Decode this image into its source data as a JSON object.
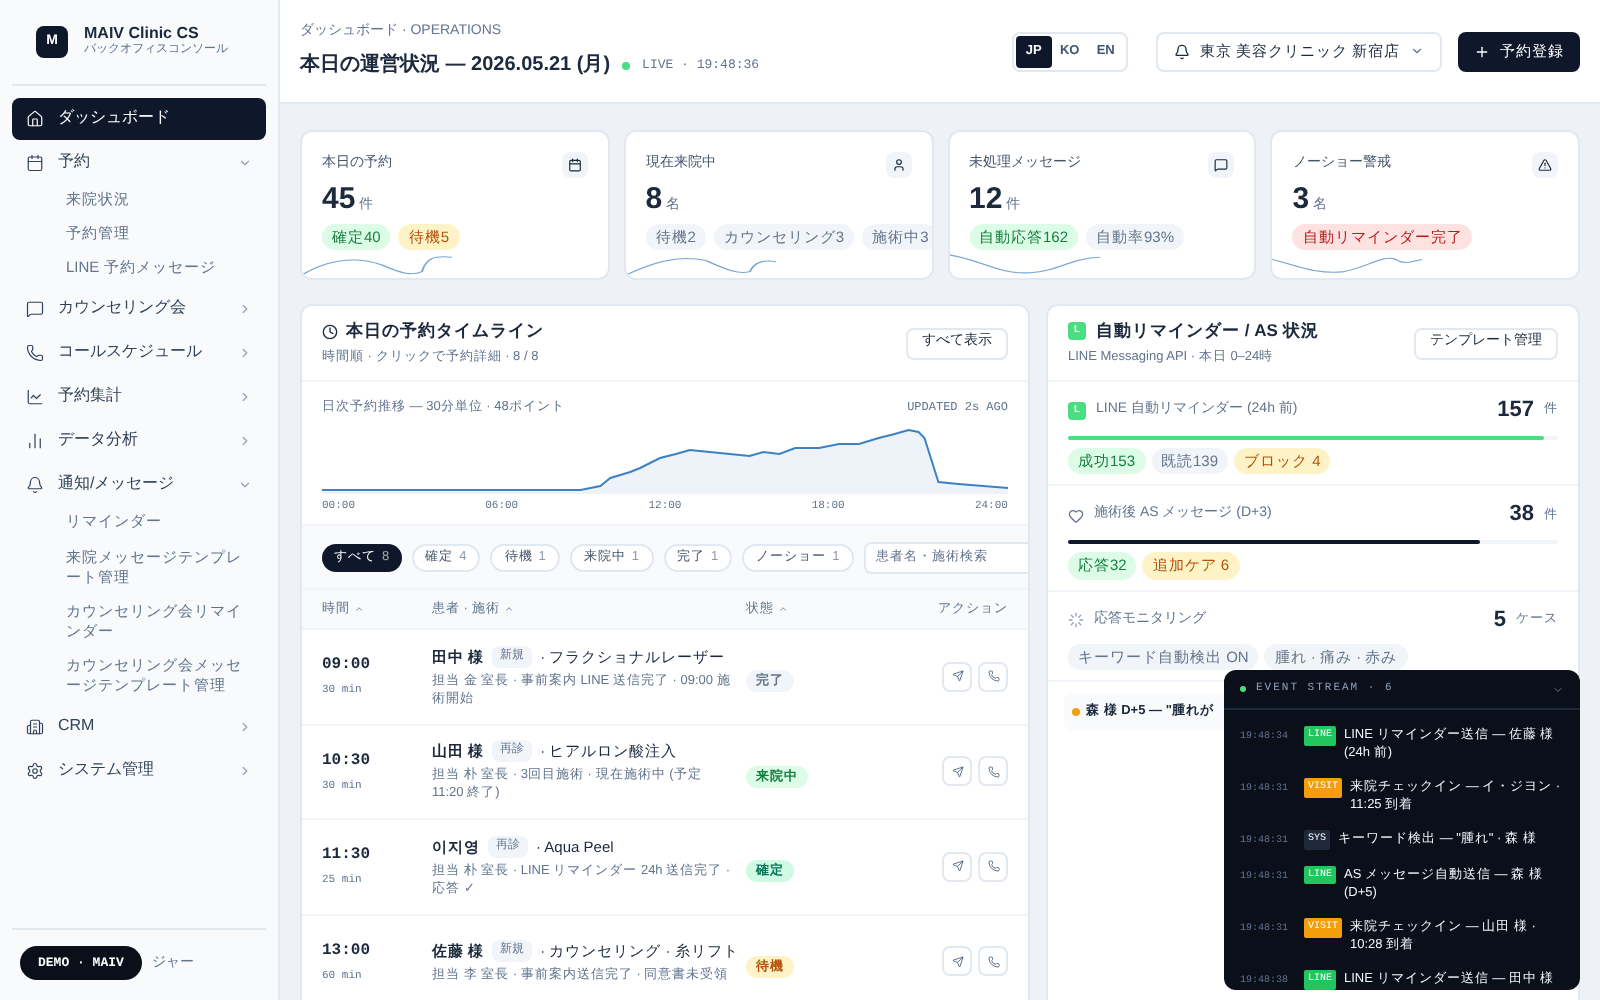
{
  "sidebar": {
    "logo": "M",
    "brand": "MAIV Clinic CS",
    "subtitle": "バックオフィスコンソール",
    "nav": [
      {
        "label": "ダッシュボード",
        "selected": true
      },
      {
        "label": "予約",
        "selected": false,
        "expanded": true,
        "children": [
          {
            "label": "来院状況"
          },
          {
            "label": "予約管理"
          },
          {
            "label": "LINE 予約メッセージ"
          }
        ]
      },
      {
        "label": "カウンセリング会",
        "selected": false,
        "expanded": false
      },
      {
        "label": "コールスケジュール",
        "selected": false,
        "expanded": false
      },
      {
        "label": "予約集計",
        "selected": false,
        "expanded": false
      },
      {
        "label": "データ分析",
        "selected": false,
        "expanded": false
      },
      {
        "label": "通知/メッセージ",
        "selected": false,
        "expanded": true,
        "children": [
          {
            "label": "リマインダー"
          },
          {
            "label": "来院メッセージテンプレート管理"
          },
          {
            "label": "カウンセリング会リマインダー"
          },
          {
            "label": "カウンセリング会メッセージテンプレート管理"
          }
        ]
      },
      {
        "label": "CRM",
        "selected": false,
        "expanded": false
      },
      {
        "label": "システム管理",
        "selected": false,
        "expanded": false
      }
    ],
    "footer_role": "ジャー"
  },
  "header": {
    "breadcrumb": "ダッシュボード · OPERATIONS",
    "title": "本日の運営状況 — 2026.05.21 (月)",
    "live": "LIVE · 19:48:36",
    "languages": [
      {
        "label": "JP",
        "selected": true
      },
      {
        "label": "KO",
        "selected": false
      },
      {
        "label": "EN",
        "selected": false
      }
    ],
    "clinic": "東京 美容クリニック 新宿店",
    "primary_button": "予約登録"
  },
  "stat_cards": [
    {
      "label": "本日の予約",
      "value": "45",
      "unit": "件",
      "tags": [
        {
          "label": "確定40",
          "color": "#dcfce7"
        },
        {
          "label": "待機5",
          "color": "#fef3c7"
        }
      ]
    },
    {
      "label": "現在来院中",
      "value": "8",
      "unit": "名",
      "tags": [
        {
          "label": "待機2",
          "color": "#f1f5f9"
        },
        {
          "label": "カウンセリング3",
          "color": "#f1f5f9"
        },
        {
          "label": "施術中3",
          "color": "#f1f5f9"
        }
      ]
    },
    {
      "label": "未処理メッセージ",
      "value": "12",
      "unit": "件",
      "tags": [
        {
          "label": "自動応答162",
          "color": "#dcfce7"
        },
        {
          "label": "自動率93%",
          "color": "#f1f5f9"
        }
      ]
    },
    {
      "label": "ノーショー警戒",
      "value": "3",
      "unit": "名",
      "tags": [
        {
          "label": "自動リマインダー完了",
          "color": "#fee2e2"
        }
      ]
    }
  ],
  "timeline": {
    "title": "本日の予約タイムライン",
    "subtitle": "時間順 · クリックで予約詳細 · 8 / 8",
    "button": "すべて表示",
    "chart": {
      "caption": "日次予約推移 — 30分単位 · 48ポイント",
      "updated": "UPDATED 2s AGO",
      "x_labels": [
        "00:00",
        "06:00",
        "12:00",
        "18:00",
        "24:00"
      ]
    },
    "filters": [
      {
        "label": "すべて",
        "count": "8",
        "selected": true
      },
      {
        "label": "確定",
        "count": "4",
        "selected": false
      },
      {
        "label": "待機",
        "count": "1",
        "selected": false
      },
      {
        "label": "来院中",
        "count": "1",
        "selected": false
      },
      {
        "label": "完了",
        "count": "1",
        "selected": false
      },
      {
        "label": "ノーショー",
        "count": "1",
        "selected": false
      }
    ],
    "search": {
      "placeholder": "患者名・施術検索"
    },
    "columns": [
      {
        "label": "時間",
        "sortable": true
      },
      {
        "label": "患者 · 施術",
        "sortable": true
      },
      {
        "label": "状態",
        "sortable": true
      },
      {
        "label": "アクション",
        "sortable": false
      }
    ],
    "rows": [
      {
        "time": "09:00",
        "duration": "30 min",
        "patient": "田中 様",
        "visit": "新規",
        "treatment": "· フラクショナルレーザー",
        "detail": "担当 金 室長 · 事前案内 LINE 送信完了 · 09:00 施術開始",
        "status": "完了",
        "color": "#f1f5f9"
      },
      {
        "time": "10:30",
        "duration": "30 min",
        "patient": "山田 様",
        "visit": "再診",
        "treatment": "· ヒアルロン酸注入",
        "detail": "担当 朴 室長 · 3回目施術 · 現在施術中 (予定 11:20 終了)",
        "status": "来院中",
        "color": "#dcfce7"
      },
      {
        "time": "11:30",
        "duration": "25 min",
        "patient": "이지영",
        "visit": "再診",
        "treatment": "· Aqua Peel",
        "detail": "担当 朴 室長 · LINE リマインダー 24h 送信完了 · 応答 ✓",
        "status": "確定",
        "color": "#d1fae5"
      },
      {
        "time": "13:00",
        "duration": "60 min",
        "patient": "佐藤 様",
        "visit": "新規",
        "treatment": "· カウンセリング · 糸リフト",
        "detail": "担当 李 室長 · 事前案内送信完了 · 同意書未受領",
        "status": "待機",
        "color": "#fef3c7"
      }
    ]
  },
  "reminders": {
    "logo": "L",
    "title": "自動リマインダー / AS 状況",
    "subtitle": "LINE Messaging API · 本日 0–24時",
    "button": "テンプレート管理",
    "sections": [
      {
        "kind": "line",
        "logo": "L",
        "label": "LINE 自動リマインダー (24h 前)",
        "value": "157",
        "unit": "件",
        "level": 0.97,
        "color": "#4ade80",
        "tags": [
          {
            "label": "成功153",
            "color": "#dcfce7"
          },
          {
            "label": "既読139",
            "color": "#f1f5f9"
          },
          {
            "label": "ブロック 4",
            "color": "#fef3c7"
          }
        ]
      },
      {
        "kind": "heart",
        "label": "施術後 AS メッセージ (D+3)",
        "value": "38",
        "unit": "件",
        "level": 0.84,
        "color": "#0f172a",
        "tags": [
          {
            "label": "応答32",
            "color": "#dcfce7"
          },
          {
            "label": "追加ケア 6",
            "color": "#fef3c7"
          }
        ]
      },
      {
        "kind": "monitor",
        "label": "応答モニタリング",
        "value": "5",
        "unit": "ケース",
        "tags": [
          {
            "label": "キーワード自動検出 ON",
            "color": "#f1f5f9"
          },
          {
            "label": "腫れ · 痛み · 赤み",
            "color": "#f1f5f9"
          }
        ]
      }
    ],
    "alert": "森 様 D+5 — \"腫れが"
  },
  "event_stream": {
    "title": "EVENT STREAM · 6",
    "events": [
      {
        "time": "19:48:34",
        "tag": "LINE",
        "color": "#22c55e",
        "text": "LINE リマインダー送信 — 佐藤 様 (24h 前)"
      },
      {
        "time": "19:48:31",
        "tag": "VISIT",
        "color": "#f59e0b",
        "text": "来院チェックイン — イ・ジヨン · 11:25 到着"
      },
      {
        "time": "19:48:31",
        "tag": "SYS",
        "color": "#1e293b",
        "text": "キーワード検出 — \"腫れ\" · 森 様"
      },
      {
        "time": "19:48:31",
        "tag": "LINE",
        "color": "#22c55e",
        "text": "AS メッセージ自動送信 — 森 様 (D+5)"
      },
      {
        "time": "19:48:31",
        "tag": "VISIT",
        "color": "#f59e0b",
        "text": "来院チェックイン — 山田 様 · 10:28 到着"
      },
      {
        "time": "19:48:38",
        "tag": "LINE",
        "color": "#22c55e",
        "text": "LINE リマインダー送信 — 田中 様"
      }
    ]
  },
  "demo_badge": "DEMO · MAIV"
}
